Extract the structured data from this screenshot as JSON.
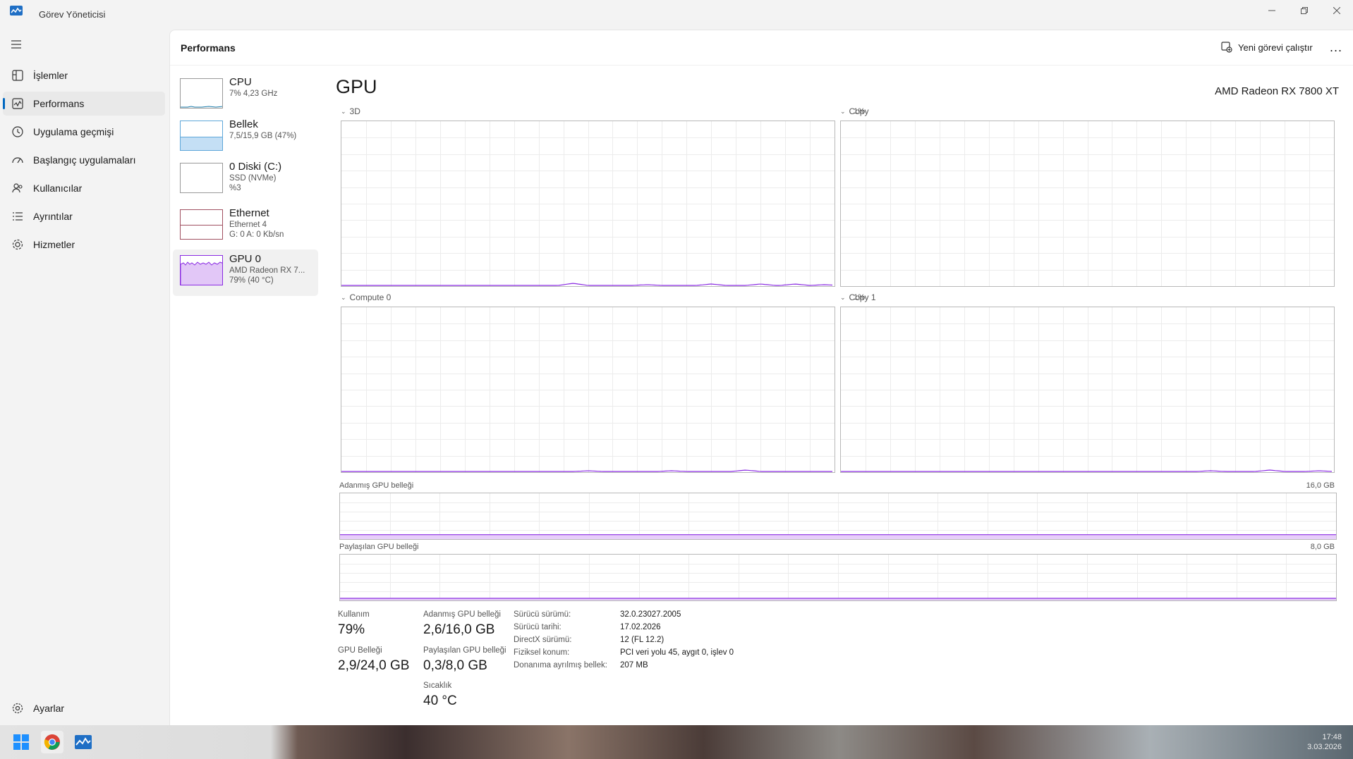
{
  "window": {
    "title": "Görev Yöneticisi"
  },
  "nav": {
    "items": [
      {
        "label": "İşlemler",
        "icon": "processes-icon"
      },
      {
        "label": "Performans",
        "icon": "performance-icon",
        "active": true
      },
      {
        "label": "Uygulama geçmişi",
        "icon": "app-history-icon"
      },
      {
        "label": "Başlangıç uygulamaları",
        "icon": "startup-icon"
      },
      {
        "label": "Kullanıcılar",
        "icon": "users-icon"
      },
      {
        "label": "Ayrıntılar",
        "icon": "details-icon"
      },
      {
        "label": "Hizmetler",
        "icon": "services-icon"
      }
    ],
    "settings_label": "Ayarlar"
  },
  "header": {
    "title": "Performans",
    "run_task": "Yeni görevi çalıştır",
    "more": "..."
  },
  "devices": [
    {
      "name": "CPU",
      "line2": "7% 4,23 GHz",
      "line3": "",
      "color": "#1f7fad",
      "fill": 0.07
    },
    {
      "name": "Bellek",
      "line2": "7,5/15,9 GB (47%)",
      "line3": "",
      "color": "#5ea7d9",
      "fill": 0.47
    },
    {
      "name": "0 Diski (C:)",
      "line2": "SSD (NVMe)",
      "line3": "%3",
      "color": "#6aa84f",
      "fill": 0.03
    },
    {
      "name": "Ethernet",
      "line2": "Ethernet 4",
      "line3": "G: 0 A: 0 Kb/sn",
      "color": "#a05060",
      "fill": 0.0
    },
    {
      "name": "GPU 0",
      "line2": "AMD Radeon RX 7...",
      "line3": "79% (40 °C)",
      "color": "#8a2be2",
      "fill": 0.79,
      "active": true
    }
  ],
  "gpu": {
    "title": "GPU",
    "model": "AMD Radeon RX 7800 XT",
    "engines": [
      {
        "label": "3D",
        "pct": "1%"
      },
      {
        "label": "Copy",
        "pct": "0%"
      },
      {
        "label": "Compute 0",
        "pct": "1%"
      },
      {
        "label": "Copy 1",
        "pct": "0%"
      }
    ],
    "dedicated_label": "Adanmış GPU belleği",
    "dedicated_max": "16,0 GB",
    "shared_label": "Paylaşılan GPU belleği",
    "shared_max": "8,0 GB",
    "accent": "#8a2be2"
  },
  "stats": {
    "usage_label": "Kullanım",
    "usage_value": "79%",
    "gpu_mem_label": "GPU Belleği",
    "gpu_mem_value": "2,9/24,0 GB",
    "ded_label": "Adanmış GPU belleği",
    "ded_value": "2,6/16,0 GB",
    "shared_label": "Paylaşılan GPU belleği",
    "shared_value": "0,3/8,0 GB",
    "temp_label": "Sıcaklık",
    "temp_value": "40 °C"
  },
  "info": [
    {
      "key": "Sürücü sürümü:",
      "value": "32.0.23027.2005"
    },
    {
      "key": "Sürücü tarihi:",
      "value": "17.02.2026"
    },
    {
      "key": "DirectX sürümü:",
      "value": "12 (FL 12.2)"
    },
    {
      "key": "Fiziksel konum:",
      "value": "PCI veri yolu 45, aygıt 0, işlev 0"
    },
    {
      "key": "Donanıma ayrılmış bellek:",
      "value": "207 MB"
    }
  ],
  "taskbar": {
    "time": "17:48",
    "date": "3.03.2026"
  }
}
